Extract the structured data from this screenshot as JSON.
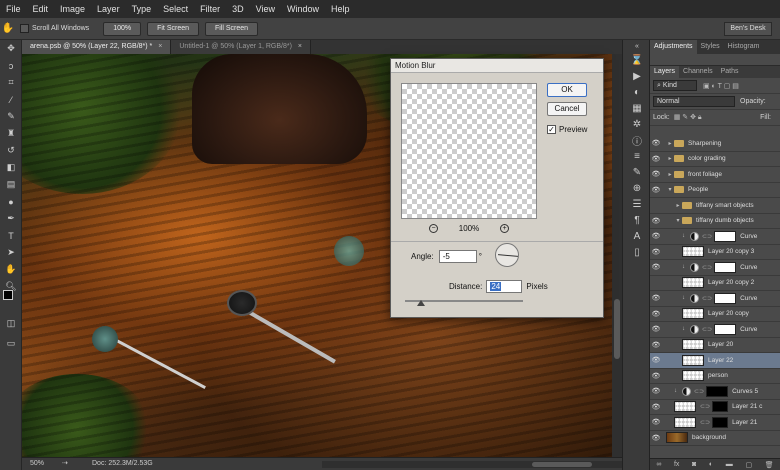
{
  "menu": [
    "File",
    "Edit",
    "Image",
    "Layer",
    "Type",
    "Select",
    "Filter",
    "3D",
    "View",
    "Window",
    "Help"
  ],
  "options": {
    "scroll_all_label": "Scroll All Windows",
    "zoom_value": "100%",
    "fit_screen": "Fit Screen",
    "fill_screen": "Fill Screen",
    "workspace": "Ben's Desk"
  },
  "tabs": [
    {
      "label": "arena.psb @ 50% (Layer 22, RGB/8*) *",
      "close": "×"
    },
    {
      "label": "Untitled-1 @ 50% (Layer 1, RGB/8*)",
      "close": "×"
    }
  ],
  "status": {
    "zoom": "50%",
    "doc": "Doc: 252.3M/2.53G"
  },
  "dialog": {
    "title": "Motion Blur",
    "ok": "OK",
    "cancel": "Cancel",
    "preview_label": "Preview",
    "preview_checked": true,
    "zoom_percent": "100%",
    "angle_label": "Angle:",
    "angle_value": "-5",
    "degree": "°",
    "distance_label": "Distance:",
    "distance_value": "24",
    "pixels": "Pixels"
  },
  "panel": {
    "tabs_top": [
      "Adjustments",
      "Styles",
      "Histogram"
    ],
    "tabs_layers": [
      "Layers",
      "Channels",
      "Paths"
    ],
    "kind": "Kind",
    "blend": "Normal",
    "opacity_label": "Opacity:",
    "lock_label": "Lock:",
    "fill_label": "Fill:",
    "layers": [
      {
        "name": "Sharpening",
        "type": "group",
        "eye": true,
        "indent": 0
      },
      {
        "name": "color grading",
        "type": "group",
        "eye": true,
        "indent": 0
      },
      {
        "name": "front foliage",
        "type": "group",
        "eye": true,
        "indent": 0
      },
      {
        "name": "People",
        "type": "group-open",
        "eye": true,
        "indent": 0
      },
      {
        "name": "tiffany smart objects",
        "type": "group",
        "eye": false,
        "indent": 1
      },
      {
        "name": "tiffany dumb objects",
        "type": "group-open",
        "eye": true,
        "indent": 1
      },
      {
        "name": "Curve",
        "type": "adjust",
        "eye": true,
        "indent": 2
      },
      {
        "name": "Layer 20 copy 3",
        "type": "pixel",
        "eye": true,
        "indent": 2
      },
      {
        "name": "Curve",
        "type": "adjust",
        "eye": true,
        "indent": 2
      },
      {
        "name": "Layer 20 copy 2",
        "type": "pixel",
        "eye": false,
        "indent": 2
      },
      {
        "name": "Curve",
        "type": "adjust",
        "eye": true,
        "indent": 2
      },
      {
        "name": "Layer 20 copy",
        "type": "pixel",
        "eye": true,
        "indent": 2
      },
      {
        "name": "Curve",
        "type": "adjust",
        "eye": true,
        "indent": 2
      },
      {
        "name": "Layer 20",
        "type": "pixel",
        "eye": true,
        "indent": 2
      },
      {
        "name": "Layer 22",
        "type": "pixel",
        "eye": true,
        "indent": 2,
        "selected": true
      },
      {
        "name": "person",
        "type": "pixel",
        "eye": true,
        "indent": 2
      },
      {
        "name": "Curves 5",
        "type": "adjust-black",
        "eye": true,
        "indent": 1
      },
      {
        "name": "Layer 21 c",
        "type": "masked",
        "eye": true,
        "indent": 1
      },
      {
        "name": "Layer 21",
        "type": "masked",
        "eye": true,
        "indent": 1
      },
      {
        "name": "background",
        "type": "photo",
        "eye": true,
        "indent": 0
      }
    ],
    "footer_icons": [
      "link-icon",
      "fx-icon",
      "mask-icon",
      "adjust-icon",
      "folder-icon",
      "new-icon",
      "trash-icon"
    ]
  }
}
